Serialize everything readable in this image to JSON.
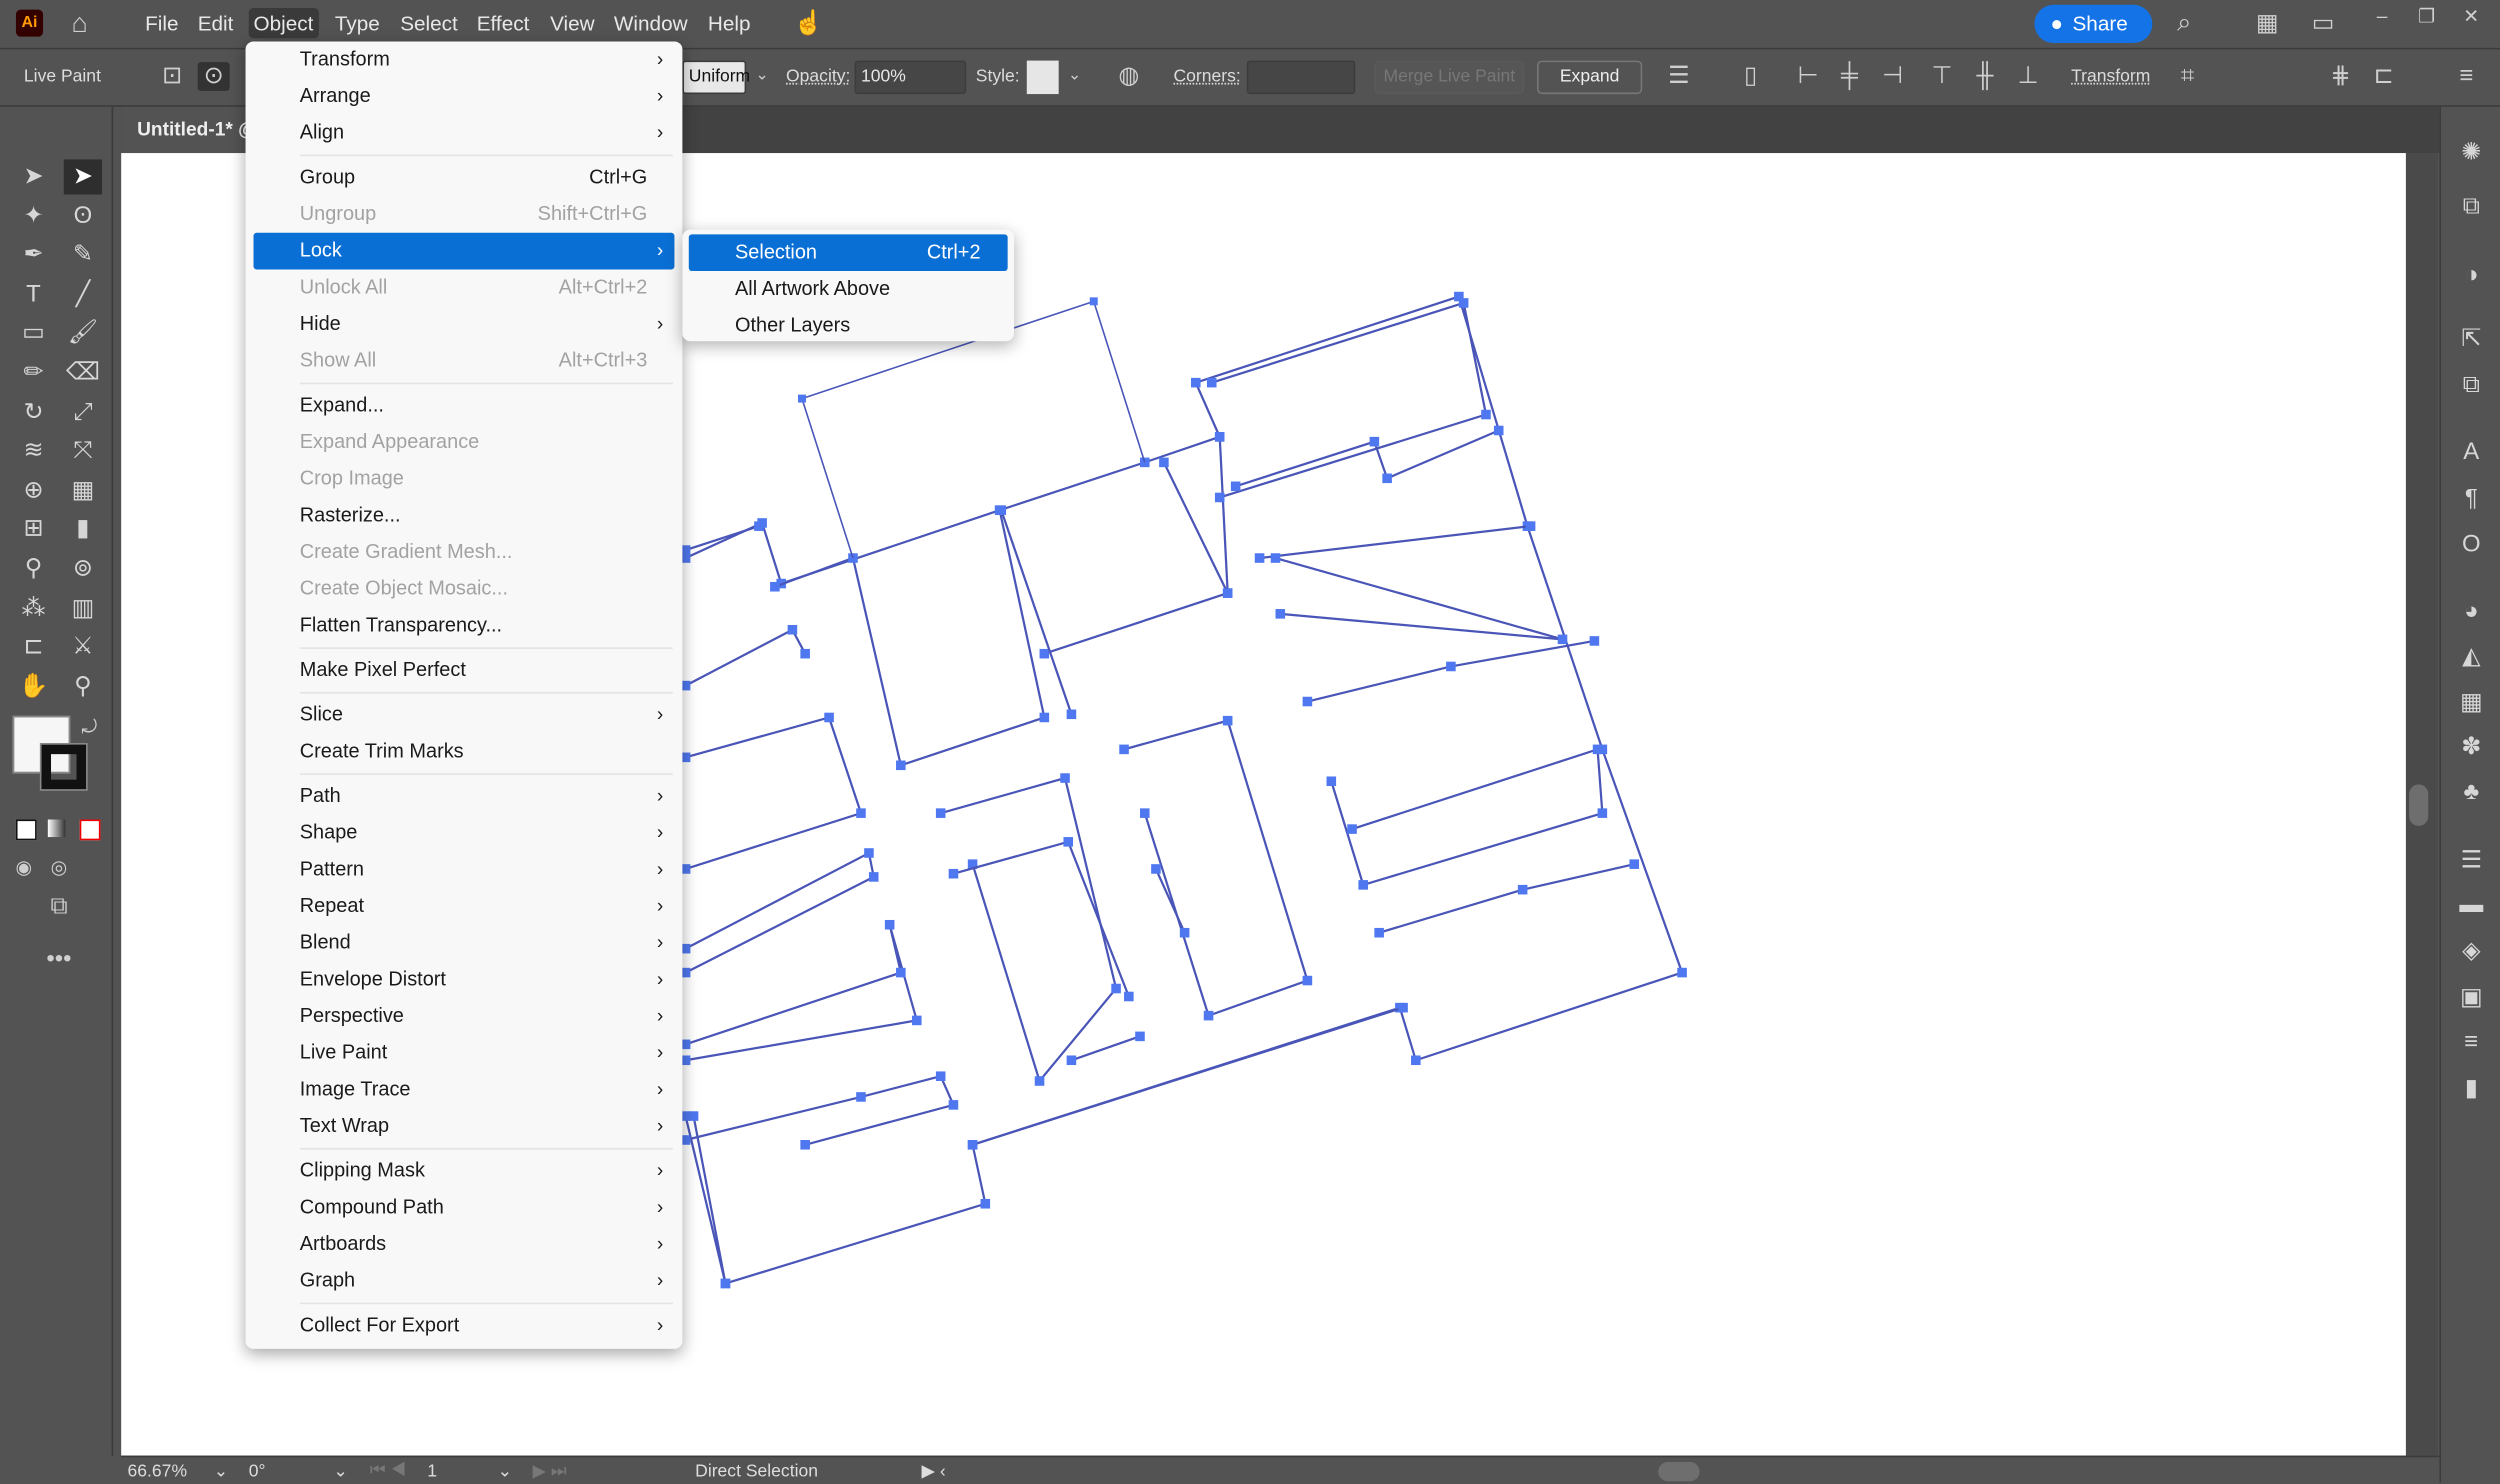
{
  "app": {
    "logo": "Ai",
    "title_tab": "Untitled-1* @"
  },
  "menubar": {
    "items": [
      "File",
      "Edit",
      "Object",
      "Type",
      "Select",
      "Effect",
      "View",
      "Window",
      "Help"
    ],
    "active": "Object",
    "share_label": "Share"
  },
  "control_bar": {
    "mode_label": "Live Paint",
    "stroke_profile": "Uniform",
    "opacity_label": "Opacity:",
    "opacity_value": "100%",
    "style_label": "Style:",
    "corners_label": "Corners:",
    "corners_value": "",
    "merge_label": "Merge Live Paint",
    "expand_label": "Expand",
    "transform_label": "Transform"
  },
  "object_menu": {
    "groups": [
      [
        {
          "label": "Transform",
          "submenu": true
        },
        {
          "label": "Arrange",
          "submenu": true
        },
        {
          "label": "Align",
          "submenu": true
        }
      ],
      [
        {
          "label": "Group",
          "shortcut": "Ctrl+G"
        },
        {
          "label": "Ungroup",
          "shortcut": "Shift+Ctrl+G",
          "disabled": true
        },
        {
          "label": "Lock",
          "submenu": true,
          "highlighted": true
        },
        {
          "label": "Unlock All",
          "shortcut": "Alt+Ctrl+2",
          "disabled": true
        },
        {
          "label": "Hide",
          "submenu": true
        },
        {
          "label": "Show All",
          "shortcut": "Alt+Ctrl+3",
          "disabled": true
        }
      ],
      [
        {
          "label": "Expand..."
        },
        {
          "label": "Expand Appearance",
          "disabled": true
        },
        {
          "label": "Crop Image",
          "disabled": true
        },
        {
          "label": "Rasterize..."
        },
        {
          "label": "Create Gradient Mesh...",
          "disabled": true
        },
        {
          "label": "Create Object Mosaic...",
          "disabled": true
        },
        {
          "label": "Flatten Transparency..."
        }
      ],
      [
        {
          "label": "Make Pixel Perfect"
        }
      ],
      [
        {
          "label": "Slice",
          "submenu": true
        },
        {
          "label": "Create Trim Marks"
        }
      ],
      [
        {
          "label": "Path",
          "submenu": true
        },
        {
          "label": "Shape",
          "submenu": true
        },
        {
          "label": "Pattern",
          "submenu": true
        },
        {
          "label": "Repeat",
          "submenu": true
        },
        {
          "label": "Blend",
          "submenu": true
        },
        {
          "label": "Envelope Distort",
          "submenu": true
        },
        {
          "label": "Perspective",
          "submenu": true
        },
        {
          "label": "Live Paint",
          "submenu": true
        },
        {
          "label": "Image Trace",
          "submenu": true
        },
        {
          "label": "Text Wrap",
          "submenu": true
        }
      ],
      [
        {
          "label": "Clipping Mask",
          "submenu": true
        },
        {
          "label": "Compound Path",
          "submenu": true
        },
        {
          "label": "Artboards",
          "submenu": true
        },
        {
          "label": "Graph",
          "submenu": true
        }
      ],
      [
        {
          "label": "Collect For Export",
          "submenu": true
        }
      ]
    ]
  },
  "lock_submenu": [
    {
      "label": "Selection",
      "shortcut": "Ctrl+2",
      "highlighted": true
    },
    {
      "label": "All Artwork Above"
    },
    {
      "label": "Other Layers"
    }
  ],
  "status_bar": {
    "zoom": "66.67%",
    "rotation": "0°",
    "artboard": "1",
    "tool": "Direct Selection"
  },
  "colors": {
    "accent": "#0a6fd4",
    "selection_path": "#4a55b8",
    "anchor": "#4f78f0",
    "workspace": "#535353"
  }
}
